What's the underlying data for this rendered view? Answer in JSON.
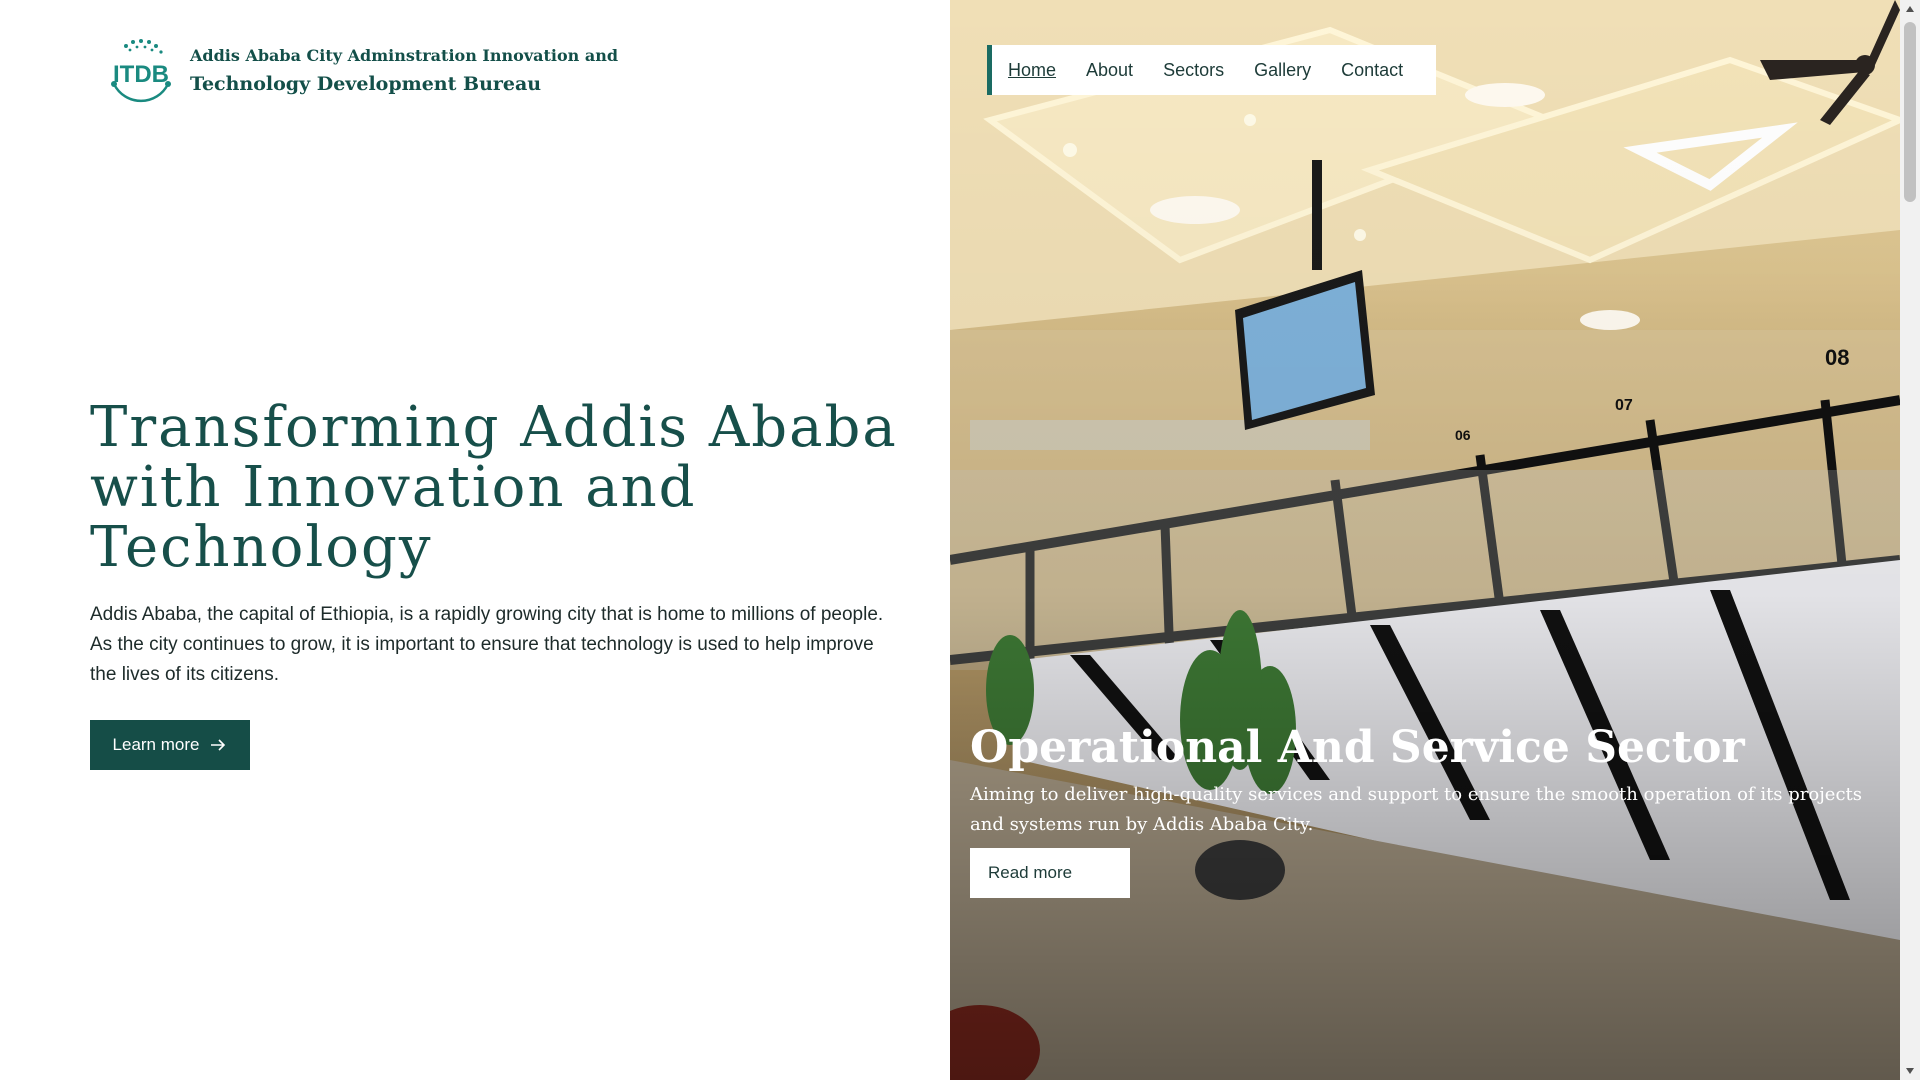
{
  "brand": {
    "line1": "Addis Ababa City Adminstration Innovation and",
    "line2": "Technology Development Bureau",
    "logo_text": "ITDB",
    "logo_color": "#1a8a80"
  },
  "hero": {
    "title": "Transforming Addis Ababa with Innovation and Technology",
    "description": "Addis Ababa, the capital of Ethiopia, is a rapidly growing city that is home to millions of people. As the city continues to grow, it is important to ensure that technology is used to help improve the lives of its citizens.",
    "button_label": "Learn more",
    "button_icon": "arrow-right-icon"
  },
  "nav": {
    "items": [
      {
        "label": "Home",
        "active": true
      },
      {
        "label": "About"
      },
      {
        "label": "Sectors"
      },
      {
        "label": "Gallery"
      },
      {
        "label": "Contact"
      }
    ]
  },
  "slide": {
    "title": "Operational And Service Sector",
    "description": "Aiming to deliver high-quality services and support to ensure the smooth operation of its projects and systems run by Addis Ababa City.",
    "button_label": "Read more",
    "counter_numbers": [
      "08",
      "07",
      "06"
    ]
  },
  "colors": {
    "primary": "#154d47",
    "accent": "#1a6b62",
    "white": "#ffffff"
  }
}
